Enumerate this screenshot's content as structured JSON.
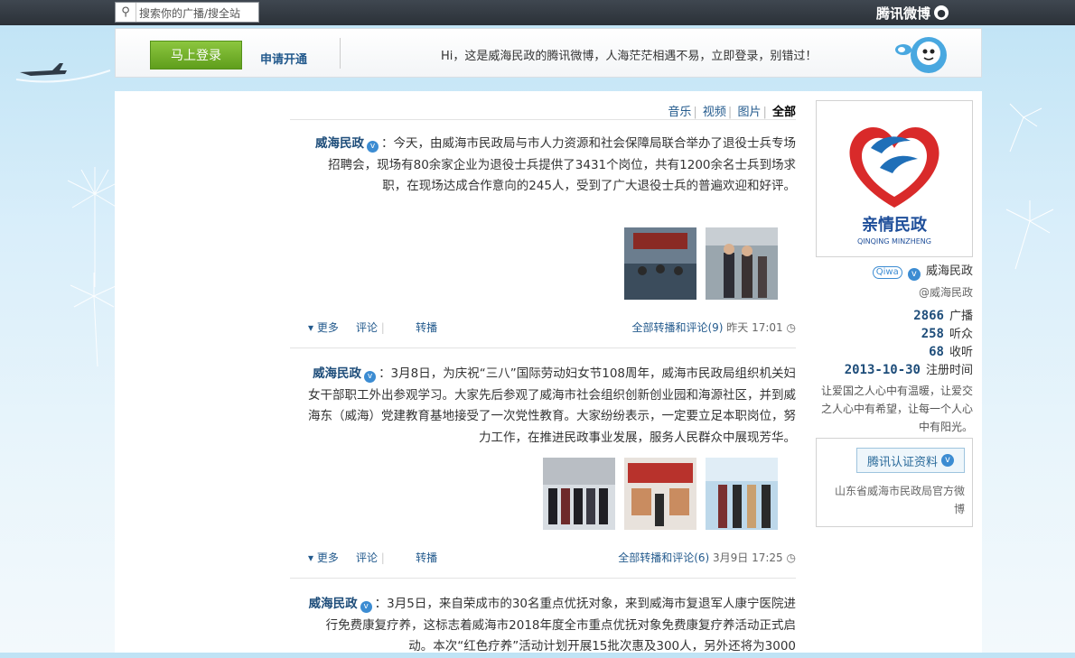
{
  "topbar": {
    "logo_text": "腾讯微博",
    "search_placeholder": "搜索你的广播/搜全站"
  },
  "banner": {
    "login_label": "马上登录",
    "apply_label": "申请开通",
    "greeting": "Hi，这是威海民政的腾讯微博，人海茫茫相遇不易，立即登录，别错过！"
  },
  "filter": {
    "items": [
      "全部",
      "图片",
      "视频",
      "音乐"
    ]
  },
  "sidebar": {
    "logo_cn": "亲情民政",
    "logo_en": "QINQING MINZHENG",
    "name": "威海民政",
    "badge": "Qiwa",
    "handle": "@威海民政",
    "stats": [
      {
        "label": "广播",
        "value": "2866"
      },
      {
        "label": "听众",
        "value": "258"
      },
      {
        "label": "收听",
        "value": "68"
      },
      {
        "label": "注册时间",
        "value": "2013-10-30"
      }
    ],
    "signature": "让爱国之人心中有温暖，让爱交之人心中有希望，让每一个人心中有阳光。",
    "auth_label": "腾讯认证资料",
    "auth_text": "山东省威海市民政局官方微博"
  },
  "posts": [
    {
      "author": "威海民政",
      "text": "：今天，由威海市民政局与市人力资源和社会保障局联合举办了退役士兵专场招聘会，现场有80余家企业为退役士兵提供了3431个岗位，共有1200余名士兵到场求职，在现场达成合作意向的245人，受到了广大退役士兵的普遍欢迎和好评。",
      "time": "昨天 17:01",
      "forward_all": "全部转播和评论(9)",
      "repost": "转播",
      "comment": "评论",
      "more": "更多"
    },
    {
      "author": "威海民政",
      "text": "：3月8日，为庆祝“三八”国际劳动妇女节108周年，威海市民政局组织机关妇女干部职工外出参观学习。大家先后参观了威海市社会组织创新创业园和海源社区，并到威海东（威海）党建教育基地接受了一次党性教育。大家纷纷表示，一定要立足本职岗位，努力工作，在推进民政事业发展，服务人民群众中展现芳华。",
      "time": "3月9日 17:25",
      "forward_all": "全部转播和评论(6)",
      "repost": "转播",
      "comment": "评论",
      "more": "更多"
    },
    {
      "author": "威海民政",
      "text": "：3月5日，来自荣成市的30名重点优抚对象，来到威海市复退军人康宁医院进行免费康复疗养，这标志着威海市2018年度全市重点优抚对象免费康复疗养活动正式启动。本次“红色疗养”活动计划开展15批次惠及300人，另外还将为3000"
    }
  ]
}
